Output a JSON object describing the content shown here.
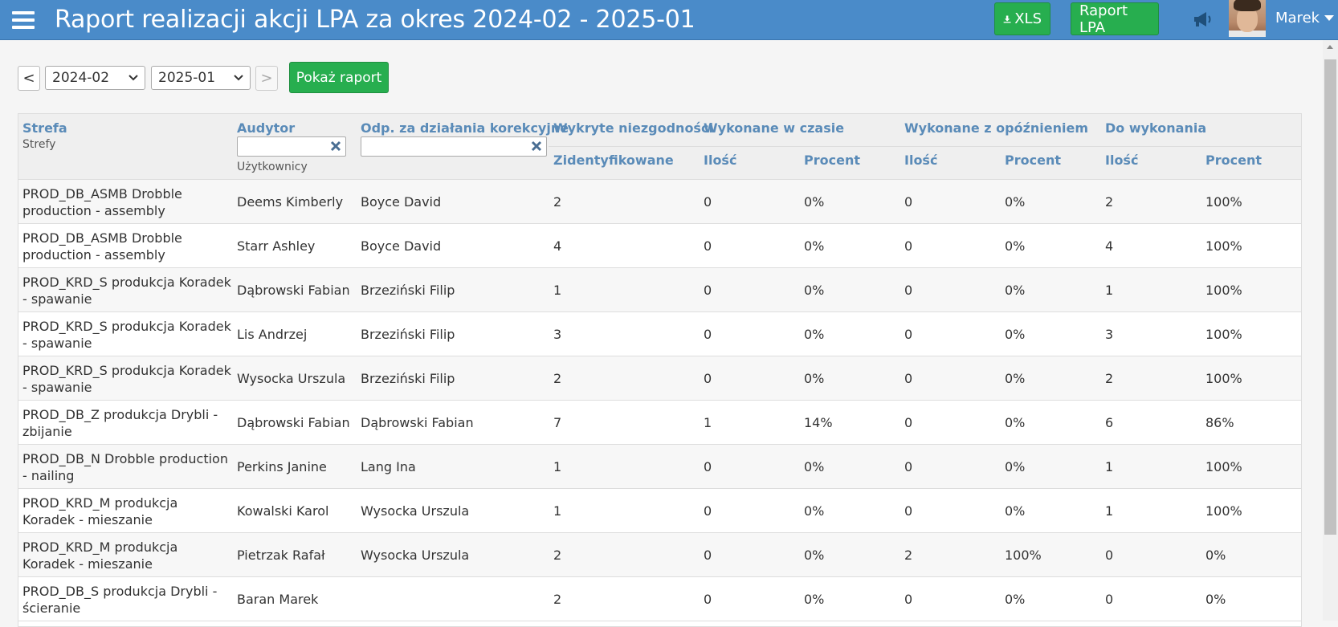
{
  "header": {
    "title": "Raport realizacji akcji LPA za okres 2024-02 - 2025-01",
    "xls_label": "XLS",
    "raport_label": "Raport LPA",
    "user_name": "Marek"
  },
  "toolbar": {
    "prev_label": "<",
    "next_label": ">",
    "from_value": "2024-02",
    "to_value": "2025-01",
    "show_label": "Pokaż raport"
  },
  "table": {
    "headers": {
      "zone": "Strefa",
      "zone_sub": "Strefy",
      "auditor": "Audytor",
      "auditor_sub": "Użytkownicy",
      "responsible": "Odp. za działania korekcyjne",
      "detected": "Wykryte niezgodności",
      "on_time": "Wykonane w czasie",
      "delayed": "Wykonane z opóźnieniem",
      "todo": "Do wykonania",
      "identified": "Zidentyfikowane",
      "qty": "Ilość",
      "percent": "Procent"
    },
    "rows": [
      {
        "zone": "PROD_DB_ASMB Drobble production - assembly",
        "auditor": "Deems Kimberly",
        "responsible": "Boyce David",
        "identified": "2",
        "on_time_qty": "0",
        "on_time_pct": "0%",
        "delayed_qty": "0",
        "delayed_pct": "0%",
        "todo_qty": "2",
        "todo_pct": "100%"
      },
      {
        "zone": "PROD_DB_ASMB Drobble production - assembly",
        "auditor": "Starr Ashley",
        "responsible": "Boyce David",
        "identified": "4",
        "on_time_qty": "0",
        "on_time_pct": "0%",
        "delayed_qty": "0",
        "delayed_pct": "0%",
        "todo_qty": "4",
        "todo_pct": "100%"
      },
      {
        "zone": "PROD_KRD_S produkcja Koradek - spawanie",
        "auditor": "Dąbrowski Fabian",
        "responsible": "Brzeziński Filip",
        "identified": "1",
        "on_time_qty": "0",
        "on_time_pct": "0%",
        "delayed_qty": "0",
        "delayed_pct": "0%",
        "todo_qty": "1",
        "todo_pct": "100%"
      },
      {
        "zone": "PROD_KRD_S produkcja Koradek - spawanie",
        "auditor": "Lis Andrzej",
        "responsible": "Brzeziński Filip",
        "identified": "3",
        "on_time_qty": "0",
        "on_time_pct": "0%",
        "delayed_qty": "0",
        "delayed_pct": "0%",
        "todo_qty": "3",
        "todo_pct": "100%"
      },
      {
        "zone": "PROD_KRD_S produkcja Koradek - spawanie",
        "auditor": "Wysocka Urszula",
        "responsible": "Brzeziński Filip",
        "identified": "2",
        "on_time_qty": "0",
        "on_time_pct": "0%",
        "delayed_qty": "0",
        "delayed_pct": "0%",
        "todo_qty": "2",
        "todo_pct": "100%"
      },
      {
        "zone": "PROD_DB_Z produkcja Drybli - zbijanie",
        "auditor": "Dąbrowski Fabian",
        "responsible": "Dąbrowski Fabian",
        "identified": "7",
        "on_time_qty": "1",
        "on_time_pct": "14%",
        "delayed_qty": "0",
        "delayed_pct": "0%",
        "todo_qty": "6",
        "todo_pct": "86%"
      },
      {
        "zone": "PROD_DB_N Drobble production - nailing",
        "auditor": "Perkins Janine",
        "responsible": "Lang Ina",
        "identified": "1",
        "on_time_qty": "0",
        "on_time_pct": "0%",
        "delayed_qty": "0",
        "delayed_pct": "0%",
        "todo_qty": "1",
        "todo_pct": "100%"
      },
      {
        "zone": "PROD_KRD_M produkcja Koradek - mieszanie",
        "auditor": "Kowalski Karol",
        "responsible": "Wysocka Urszula",
        "identified": "1",
        "on_time_qty": "0",
        "on_time_pct": "0%",
        "delayed_qty": "0",
        "delayed_pct": "0%",
        "todo_qty": "1",
        "todo_pct": "100%"
      },
      {
        "zone": "PROD_KRD_M produkcja Koradek - mieszanie",
        "auditor": "Pietrzak Rafał",
        "responsible": "Wysocka Urszula",
        "identified": "2",
        "on_time_qty": "0",
        "on_time_pct": "0%",
        "delayed_qty": "2",
        "delayed_pct": "100%",
        "todo_qty": "0",
        "todo_pct": "0%"
      },
      {
        "zone": "PROD_DB_S produkcja Drybli - ścieranie",
        "auditor": "Baran Marek",
        "responsible": "",
        "identified": "2",
        "on_time_qty": "0",
        "on_time_pct": "0%",
        "delayed_qty": "0",
        "delayed_pct": "0%",
        "todo_qty": "0",
        "todo_pct": "0%"
      }
    ]
  },
  "colors": {
    "header_bg": "#4a8bc9",
    "button_green": "#27ae4f",
    "column_header_text": "#5a8bb8"
  },
  "icons": {
    "menu": "hamburger-icon",
    "download": "download-icon",
    "announcement": "megaphone-icon",
    "dropdown": "caret-down-icon",
    "clear": "clear-x-icon"
  }
}
